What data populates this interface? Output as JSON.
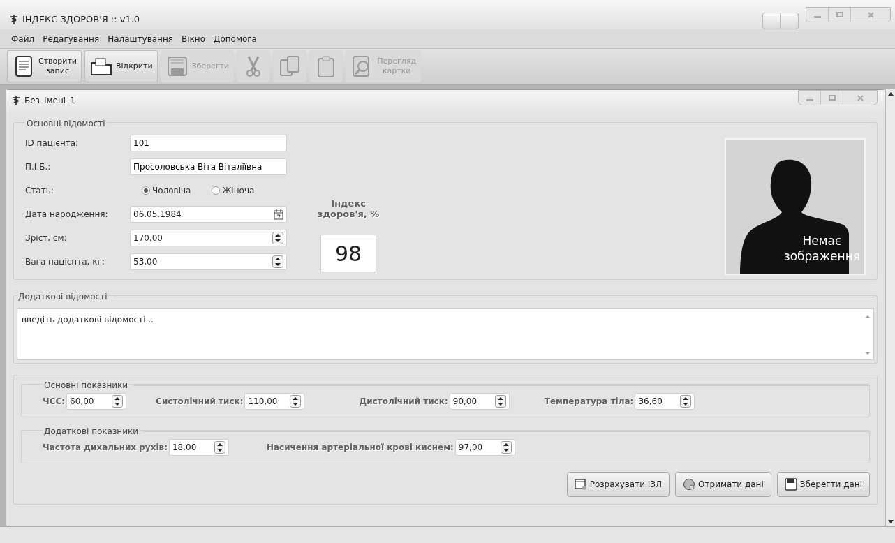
{
  "window": {
    "title": "ІНДЕКС ЗДОРОВ'Я :: v1.0"
  },
  "menu": [
    "Файл",
    "Редагування",
    "Налаштування",
    "Вікно",
    "Допомога"
  ],
  "toolbar": [
    {
      "label": "Створити\nзапис",
      "disabled": false
    },
    {
      "label": "Відкрити",
      "disabled": false
    },
    {
      "label": "Зберегти",
      "disabled": true
    },
    {
      "disabled": true
    },
    {
      "disabled": true
    },
    {
      "disabled": true
    },
    {
      "label": "Перегляд\nкартки",
      "disabled": true
    }
  ],
  "document": {
    "title": "Без_Імені_1",
    "basic_info": {
      "title": "Основні відомості",
      "fields": [
        {
          "kind": "text",
          "label": "ID пацієнта:",
          "value": "101"
        },
        {
          "kind": "text",
          "label": "П.І.Б.:",
          "value": "Просоловська Віта Віталіївна"
        },
        {
          "kind": "radio",
          "label": "Стать:",
          "options": [
            {
              "label": "Чоловіча",
              "selected": true
            },
            {
              "label": "Жіноча",
              "selected": false
            }
          ]
        },
        {
          "kind": "date",
          "label": "Дата народження:",
          "value": "06.05.1984"
        },
        {
          "kind": "spin",
          "label": "Зріст, см:",
          "value": "170,00"
        },
        {
          "kind": "spin",
          "label": "Вага пацієнта, кг:",
          "value": "53,00"
        }
      ],
      "health_index": {
        "label": "Індекс\nздоров'я, %",
        "value": "98"
      },
      "photo": {
        "caption": "Немає\nзображення"
      }
    },
    "extra_info": {
      "title": "Додаткові відомості",
      "placeholder": "введіть додаткові відомості..."
    },
    "indicators": [
      {
        "title": "Основні показники",
        "fields": [
          {
            "label": "ЧСС:",
            "value": "60,00"
          },
          {
            "label": "Систолічний тиск:",
            "value": "110,00"
          },
          {
            "label": "Дистолічний тиск:",
            "value": "90,00"
          },
          {
            "label": "Температура тіла:",
            "value": "36,60"
          }
        ]
      },
      {
        "title": "Додаткові показники",
        "fields": [
          {
            "label": "Частота дихальних рухів:",
            "value": "18,00"
          },
          {
            "label": "Насичення артеріальної крові киснем:",
            "value": "97,00"
          }
        ]
      }
    ],
    "buttons": [
      {
        "label": "Розрахувати ІЗЛ"
      },
      {
        "label": "Отримати дані"
      },
      {
        "label": "Зберегти дані"
      }
    ]
  }
}
